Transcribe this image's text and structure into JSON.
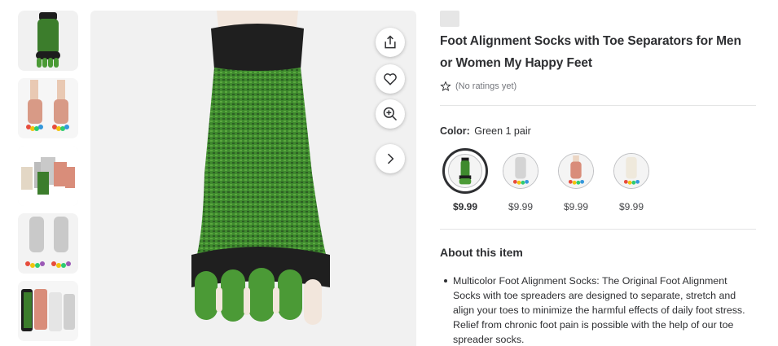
{
  "thumbnails": [
    {
      "name": "thumbnail-green-sock"
    },
    {
      "name": "thumbnail-rainbow-socks-feet"
    },
    {
      "name": "thumbnail-sock-assortment"
    },
    {
      "name": "thumbnail-gray-socks-feet"
    },
    {
      "name": "thumbnail-sock-pairs"
    }
  ],
  "image_actions": {
    "share": "share-icon",
    "favorite": "heart-icon",
    "zoom": "zoom-in-icon",
    "next": "chevron-right-icon"
  },
  "product": {
    "title": "Foot Alignment Socks with Toe Separators for Men or Women My Happy Feet",
    "rating_text": "(No ratings yet)"
  },
  "color": {
    "label": "Color:",
    "value": "Green 1 pair"
  },
  "variants": [
    {
      "price": "$9.99",
      "selected": true,
      "color": "#3f8a2e"
    },
    {
      "price": "$9.99",
      "selected": false,
      "color": "#cfcfcf"
    },
    {
      "price": "$9.99",
      "selected": false,
      "color": "#d98d7a"
    },
    {
      "price": "$9.99",
      "selected": false,
      "color": "#efe9dc"
    }
  ],
  "about": {
    "title": "About this item",
    "bullets": [
      "Multicolor Foot Alignment Socks: The Original Foot Alignment Socks with toe spreaders are designed to separate, stretch and align your toes to minimize the harmful effects of daily foot stress. Relief from chronic foot pain is possible with the help of our toe spreader socks."
    ]
  }
}
